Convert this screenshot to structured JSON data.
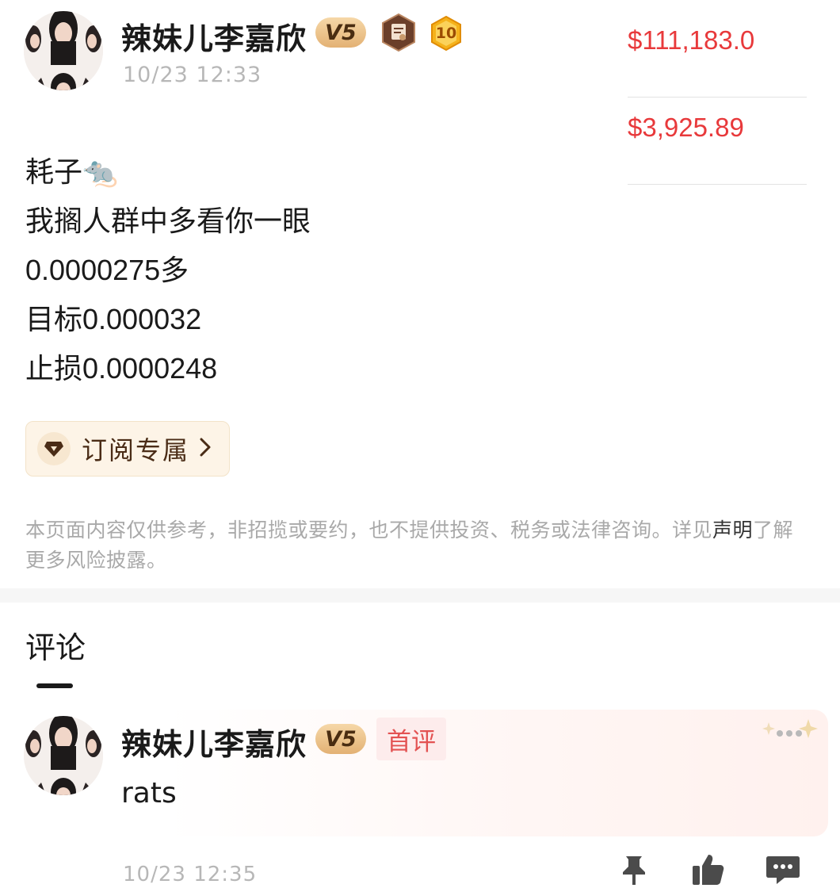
{
  "post": {
    "author": {
      "name": "辣妹儿李嘉欣",
      "vip_badge": "V5",
      "level_badge": "10"
    },
    "time": "10/23 12:33",
    "lines": [
      "耗子🐀",
      "我搁人群中多看你一眼",
      "0.0000275多",
      "目标0.000032",
      "止损0.0000248"
    ],
    "subscribe_label": "订阅专属"
  },
  "prices": [
    "$111,183.0",
    "$3,925.89"
  ],
  "disclaimer": {
    "text": "本页面内容仅供参考，非招揽或要约，也不提供投资、税务或法律咨询。详见",
    "link_a": "声明",
    "text_end": "了解更多风险披露。"
  },
  "comments": {
    "title": "评论",
    "items": [
      {
        "author": "辣妹儿李嘉欣",
        "vip_badge": "V5",
        "tag": "首评",
        "text": "rats",
        "time": "10/23 12:35"
      }
    ]
  },
  "icons": {
    "level_medal": "medal-icon",
    "achievement": "hexagon-achievement-icon",
    "subscribe": "diamond-icon",
    "chevron": "chevron-right-icon",
    "more": "more-sparkle-icon",
    "pin": "pin-icon",
    "like": "thumbs-up-icon",
    "reply": "comment-icon"
  },
  "colors": {
    "price": "#e8393b",
    "tag_bg": "#fdecec",
    "tag_text": "#e35252",
    "badge_gold": "#e3b174"
  }
}
